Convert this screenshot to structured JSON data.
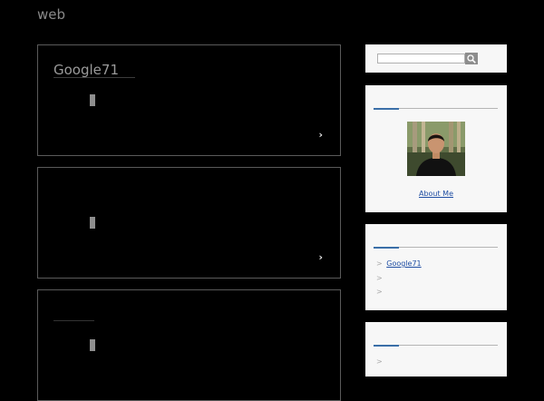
{
  "site": {
    "title": "web"
  },
  "posts": [
    {
      "title": "Google71",
      "more": "›"
    },
    {
      "title": "",
      "more": "›"
    },
    {
      "title": "",
      "more": ""
    }
  ],
  "sidebar": {
    "search": {
      "placeholder": "",
      "button_icon": "search-icon"
    },
    "about": {
      "link_label": "About Me"
    },
    "links": {
      "items": [
        {
          "arrow": ">",
          "label": "Google71"
        },
        {
          "arrow": ">",
          "label": ""
        },
        {
          "arrow": ">",
          "label": ""
        }
      ]
    },
    "bottom": {
      "arrow": ">"
    }
  },
  "colors": {
    "background": "#000000",
    "accent": "#3b6fa8",
    "widget_bg": "#f7f7f7",
    "link": "#1f4ea3"
  }
}
